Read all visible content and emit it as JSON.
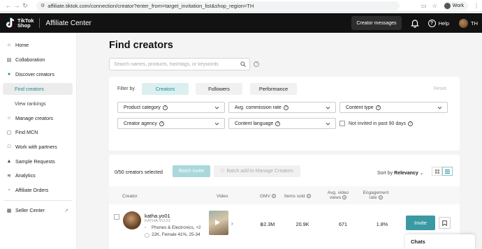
{
  "browser": {
    "url": "affiliate.tiktok.com/connection/creator?enter_from=target_invitation_list&shop_region=TH",
    "profile_label": "Work"
  },
  "header": {
    "logo_line1": "TikTok",
    "logo_line2": "Shop",
    "app_title": "Affiliate Center",
    "messages_label": "Creator messages",
    "help_label": "Help",
    "user_label": "TH"
  },
  "sidebar": {
    "items": [
      {
        "label": "Home",
        "icon": "home-icon"
      },
      {
        "label": "Collaboration",
        "icon": "collaboration-icon"
      },
      {
        "label": "Discover creators",
        "icon": "discover-icon"
      },
      {
        "label": "Find creators",
        "sub": true,
        "active": true
      },
      {
        "label": "View rankings",
        "sub": true
      },
      {
        "label": "Manage creators",
        "icon": "manage-icon"
      },
      {
        "label": "Find MCN",
        "icon": "mcn-icon"
      },
      {
        "label": "Work with partners",
        "icon": "partners-icon"
      },
      {
        "label": "Sample Requests",
        "icon": "sample-icon"
      },
      {
        "label": "Analytics",
        "icon": "analytics-icon"
      },
      {
        "label": "Affiliate Orders",
        "icon": "orders-icon"
      },
      {
        "label": "Seller Center",
        "icon": "seller-icon",
        "external": true
      }
    ]
  },
  "main": {
    "title": "Find creators",
    "search_placeholder": "Search names, products, hashtags, or keywords",
    "filter": {
      "label": "Filter by",
      "segments": [
        "Creators",
        "Followers",
        "Performance"
      ],
      "active_segment": "Creators",
      "reset_label": "Reset",
      "dropdowns": [
        "Product category",
        "Avg. commission rate",
        "Content type",
        "Creator agency",
        "Content language"
      ],
      "checkbox_label": "Not invited in past 90 days"
    },
    "results": {
      "selected_count": "0/50 creators selected",
      "batch_invite": "Batch invite",
      "batch_add": "Batch add to Manage Creators",
      "sort_prefix": "Sort by",
      "sort_value": "Relevancy",
      "columns": {
        "creator": "Creator",
        "video": "Video",
        "gmv": "GMV",
        "items_sold": "Items sold",
        "avg_views": "Avg. video views",
        "engagement": "Engagement rate"
      },
      "rows": [
        {
          "handle": "katha.yo01",
          "nickname": "KATHA.YO.01",
          "category": "Phones & Electronics, +2",
          "audience": "22K, Female 41%, 25-34",
          "gmv": "฿2.3M",
          "items_sold": "20.9K",
          "avg_views": "671",
          "engagement": "1.8%",
          "invite_label": "Invite"
        }
      ]
    }
  },
  "chats_label": "Chats",
  "colors": {
    "accent": "#3a9aa3",
    "header_bg": "#121212"
  }
}
